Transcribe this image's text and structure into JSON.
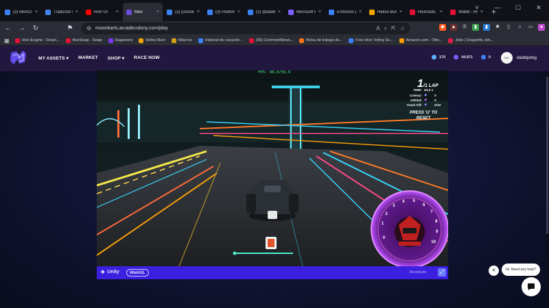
{
  "browser": {
    "tabs": [
      {
        "title": "(3) MemO",
        "color": "#3b82f6"
      },
      {
        "title": "Traductor d",
        "color": "#4285f4"
      },
      {
        "title": "RAP DI",
        "color": "#ff0000"
      },
      {
        "title": "Moo",
        "color": "#6b4bd8",
        "active": true
      },
      {
        "title": "(3) [Docker",
        "color": "#3b82f6"
      },
      {
        "title": "(3) Publish",
        "color": "#3b82f6"
      },
      {
        "title": "(3) @daddy",
        "color": "#3b82f6"
      },
      {
        "title": "Microsoft C",
        "color": "#7b61ff"
      },
      {
        "title": "Entonces g",
        "color": "#3b82f6"
      },
      {
        "title": "Helios Bum",
        "color": "#f0a500"
      },
      {
        "title": "HiveStats",
        "color": "#e31337"
      },
      {
        "title": "Wallet - Hive",
        "color": "#e31337"
      }
    ],
    "new_tab_label": "+",
    "window_controls": [
      "˅",
      "—",
      "☐",
      "✕"
    ],
    "url": "moonkarts.arcadecolony.com/play",
    "bookmarks": [
      {
        "label": "Hive-Engine - Smart...",
        "color": "#e31337"
      },
      {
        "label": "BeeSwap - Swap",
        "color": "#e31337"
      },
      {
        "label": "Dagamers",
        "color": "#7c3aed"
      },
      {
        "label": "Helios Bum",
        "color": "#f0a500"
      },
      {
        "label": "iMacros",
        "color": "#d4a017"
      },
      {
        "label": "Historial de curación...",
        "color": "#3b82f6"
      },
      {
        "label": "(68) CommentNews...",
        "color": "#e31337"
      },
      {
        "label": "Bolsa de trabajo de...",
        "color": "#f97316"
      },
      {
        "label": "Free Hive Voting Se...",
        "color": "#3b82f6"
      },
      {
        "label": "Amazon.com - Ofer...",
        "color": "#ff9900"
      },
      {
        "label": "Jobs | Dragonfly Job...",
        "color": "#e11d48"
      }
    ]
  },
  "site": {
    "nav": [
      "MY ASSETS ▾",
      "MARKET",
      "SHOP ▾",
      "RACE NOW"
    ],
    "stats": [
      {
        "value": "170",
        "color": "#5ab0ff"
      },
      {
        "value": "44.871",
        "color": "#7c5cff"
      },
      {
        "value": "0",
        "color": "#3b82f6"
      }
    ],
    "avatar_text": "GA",
    "username": "daddydog"
  },
  "game": {
    "fps": "FPS: 60,0/59,9",
    "lap_big": "1",
    "lap_small": "/1 LAP",
    "time_label": "TIME:",
    "time_value": "53,5 s",
    "colony_label": "Colony:",
    "colony_value": "0",
    "orbital_label": "Orbital:",
    "orbital_value": "0",
    "track_fill_label": "Track Fill:",
    "track_fill_value": "0/10",
    "reset_line1": "PRESS 'U' TO",
    "reset_line2": "RESET",
    "speedometer_ticks": [
      "1",
      "2",
      "3",
      "4",
      "5",
      "6",
      "7",
      "8",
      "9",
      "10",
      "0"
    ],
    "unity_label": "Unity",
    "webgl_label": "WebGL",
    "moonkarts_label": "MoonKarts"
  },
  "chat": {
    "close": "✕",
    "bubble": "Hi. Need any help?"
  }
}
